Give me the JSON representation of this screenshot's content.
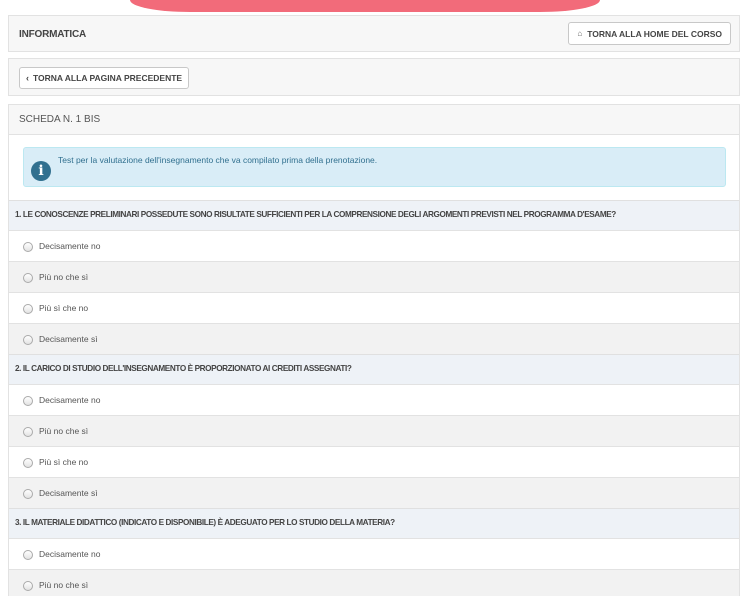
{
  "course": {
    "title": "INFORMATICA",
    "home_button": "TORNA ALLA HOME DEL CORSO",
    "back_button": "TORNA ALLA PAGINA PRECEDENTE"
  },
  "sheet": {
    "title": "SCHEDA N. 1 BIS",
    "info": "Test per la valutazione dell'insegnamento che va compilato prima della prenotazione."
  },
  "questions": [
    {
      "text": "1. LE CONOSCENZE PRELIMINARI POSSEDUTE SONO RISULTATE SUFFICIENTI PER LA COMPRENSIONE DEGLI ARGOMENTI PREVISTI NEL PROGRAMMA D'ESAME?",
      "options": [
        "Decisamente no",
        "Più no che sì",
        "Più sì che no",
        "Decisamente sì"
      ]
    },
    {
      "text": "2. IL CARICO DI STUDIO DELL'INSEGNAMENTO È PROPORZIONATO AI CREDITI ASSEGNATI?",
      "options": [
        "Decisamente no",
        "Più no che sì",
        "Più sì che no",
        "Decisamente sì"
      ]
    },
    {
      "text": "3. IL MATERIALE DIDATTICO (INDICATO E DISPONIBILE) È ADEGUATO PER LO STUDIO DELLA MATERIA?",
      "options": [
        "Decisamente no",
        "Più no che sì"
      ]
    }
  ],
  "colors": {
    "brand_bar": "#f15b6c",
    "info_bg": "#d9edf7",
    "info_icon": "#31708f"
  },
  "icons": {
    "home": "home-icon",
    "back": "chevron-left-icon",
    "info": "info-icon",
    "radio": "radio-unchecked"
  }
}
